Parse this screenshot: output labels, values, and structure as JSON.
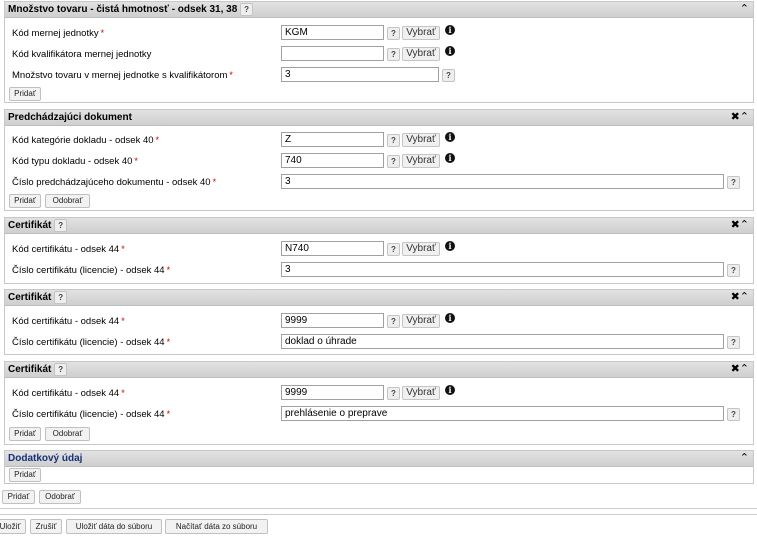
{
  "s1": {
    "title": "Množstvo tovaru - čistá hmotnosť - odsek 31, 38",
    "help": "?",
    "rows": [
      {
        "label": "Kód mernej jednotky",
        "req": "*",
        "value": "KGM",
        "help": "?",
        "select_label": "Vybrať",
        "info": "i"
      },
      {
        "label": "Kód kvalifikátora mernej jednotky",
        "req": "",
        "value": "",
        "help": "?",
        "select_label": "Vybrať",
        "info": "i"
      },
      {
        "label": "Množstvo tovaru v mernej jednotke s kvalifikátorom",
        "req": "*",
        "value": "3",
        "help": "?"
      }
    ],
    "add_label": "Pridať",
    "icons": "⌃"
  },
  "s2": {
    "title": "Predchádzajúci dokument",
    "icons": "✖⌃",
    "rows": [
      {
        "label": "Kód kategórie dokladu - odsek 40",
        "req": "*",
        "value": "Z",
        "help": "?",
        "select_label": "Vybrať",
        "info": "i"
      },
      {
        "label": "Kód typu dokladu - odsek 40",
        "req": "*",
        "value": "740",
        "help": "?",
        "select_label": "Vybrať",
        "info": "i"
      },
      {
        "label": "Číslo predchádzajúceho dokumentu - odsek 40",
        "req": "*",
        "value": "3",
        "help": "?"
      }
    ],
    "add_label": "Pridať",
    "remove_label": "Odobrať"
  },
  "s3": {
    "title": "Certifikát",
    "help": "?",
    "icons": "✖⌃",
    "rows": [
      {
        "label": "Kód certifikátu - odsek 44",
        "req": "*",
        "value": "N740",
        "help": "?",
        "select_label": "Vybrať",
        "info": "i"
      },
      {
        "label": "Číslo certifikátu (licencie) - odsek 44",
        "req": "*",
        "value": "3",
        "help": "?"
      }
    ]
  },
  "s4": {
    "title": "Certifikát",
    "help": "?",
    "icons": "✖⌃",
    "rows": [
      {
        "label": "Kód certifikátu - odsek 44",
        "req": "*",
        "value": "9999",
        "help": "?",
        "select_label": "Vybrať",
        "info": "i"
      },
      {
        "label": "Číslo certifikátu (licencie) - odsek 44",
        "req": "*",
        "value": "doklad o úhrade",
        "help": "?"
      }
    ]
  },
  "s5": {
    "title": "Certifikát",
    "help": "?",
    "icons": "✖⌃",
    "rows": [
      {
        "label": "Kód certifikátu - odsek 44",
        "req": "*",
        "value": "9999",
        "help": "?",
        "select_label": "Vybrať",
        "info": "i"
      },
      {
        "label": "Číslo certifikátu (licencie) - odsek 44",
        "req": "*",
        "value": "prehlásenie o preprave",
        "help": "?"
      }
    ],
    "add_label": "Pridať",
    "remove_label": "Odobrať"
  },
  "s6": {
    "title": "Dodatkový údaj",
    "icons": "⌃",
    "add_label": "Pridať"
  },
  "outer": {
    "add_label": "Pridať",
    "remove_label": "Odobrať"
  },
  "footer": {
    "save_label": "Uložiť",
    "cancel_label": "Zrušiť",
    "save_file_label": "Uložiť dáta do súboru",
    "load_file_label": "Načítať dáta zo súboru"
  }
}
